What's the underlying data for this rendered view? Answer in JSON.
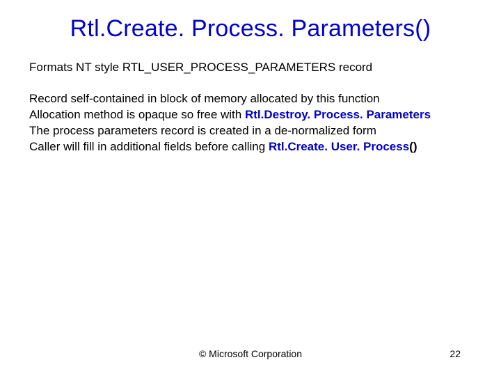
{
  "slide": {
    "title": "Rtl.Create. Process. Parameters()",
    "subtitle": "Formats NT style RTL_USER_PROCESS_PARAMETERS record",
    "lines": {
      "l1": "Record self-contained in block of memory allocated by this function",
      "l2_pre": "Allocation method is opaque so free with ",
      "l2_bold": "Rtl.Destroy. Process. Parameters",
      "l3": "The process parameters record is created in a de-normalized form",
      "l4_pre": "Caller will fill in additional fields before calling ",
      "l4_bold": "Rtl.Create. User. Process",
      "l4_post": "()"
    }
  },
  "footer": {
    "copyright": "© Microsoft Corporation",
    "page": "22"
  }
}
